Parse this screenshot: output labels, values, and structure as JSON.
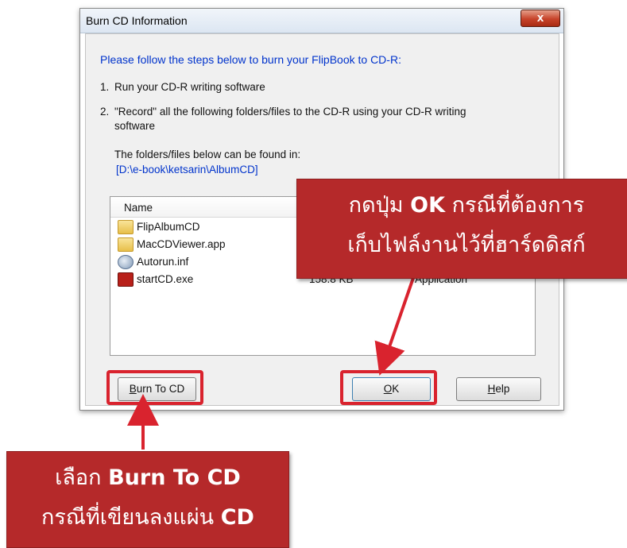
{
  "window": {
    "title": "Burn CD Information",
    "close_label": "x"
  },
  "instructions": {
    "heading": "Please follow the steps below to burn your FlipBook to CD-R:",
    "steps": [
      {
        "num": "1.",
        "text": "Run your CD-R writing software"
      },
      {
        "num": "2.",
        "text": "\"Record\" all the following folders/files to the CD-R using your CD-R writing software"
      }
    ],
    "found_in_label": "The folders/files below can be found in:",
    "path": "[D:\\e-book\\ketsarin\\AlbumCD]"
  },
  "file_list": {
    "header_name": "Name",
    "rows": [
      {
        "name": "FlipAlbumCD",
        "size": "",
        "type": "",
        "icon": "folder-icon"
      },
      {
        "name": "MacCDViewer.app",
        "size": "",
        "type": "",
        "icon": "folder-icon"
      },
      {
        "name": "Autorun.inf",
        "size": "",
        "type": "",
        "icon": "settings-file-icon"
      },
      {
        "name": "startCD.exe",
        "size": "158.8 KB",
        "type": "Application",
        "icon": "application-icon"
      }
    ]
  },
  "buttons": {
    "burn_prefix": "B",
    "burn_rest": "urn To CD",
    "ok_prefix": "O",
    "ok_rest": "K",
    "help_prefix": "H",
    "help_rest": "elp"
  },
  "callouts": {
    "ok": {
      "line1_thai": "กดปุ่ม ",
      "line1_en": "OK",
      "line1_thai2": " กรณีที่ต้องการ",
      "line2": "เก็บไฟล์งานไว้ที่ฮาร์ดดิสก์"
    },
    "burn": {
      "line1_thai": "เลือก ",
      "line1_en": "Burn To CD",
      "line2_thai": "กรณีที่เขียนลงแผ่น ",
      "line2_en": "CD"
    }
  },
  "colors": {
    "callout_bg": "#b5292a",
    "highlight": "#d9232e",
    "link_blue": "#0033cc"
  }
}
